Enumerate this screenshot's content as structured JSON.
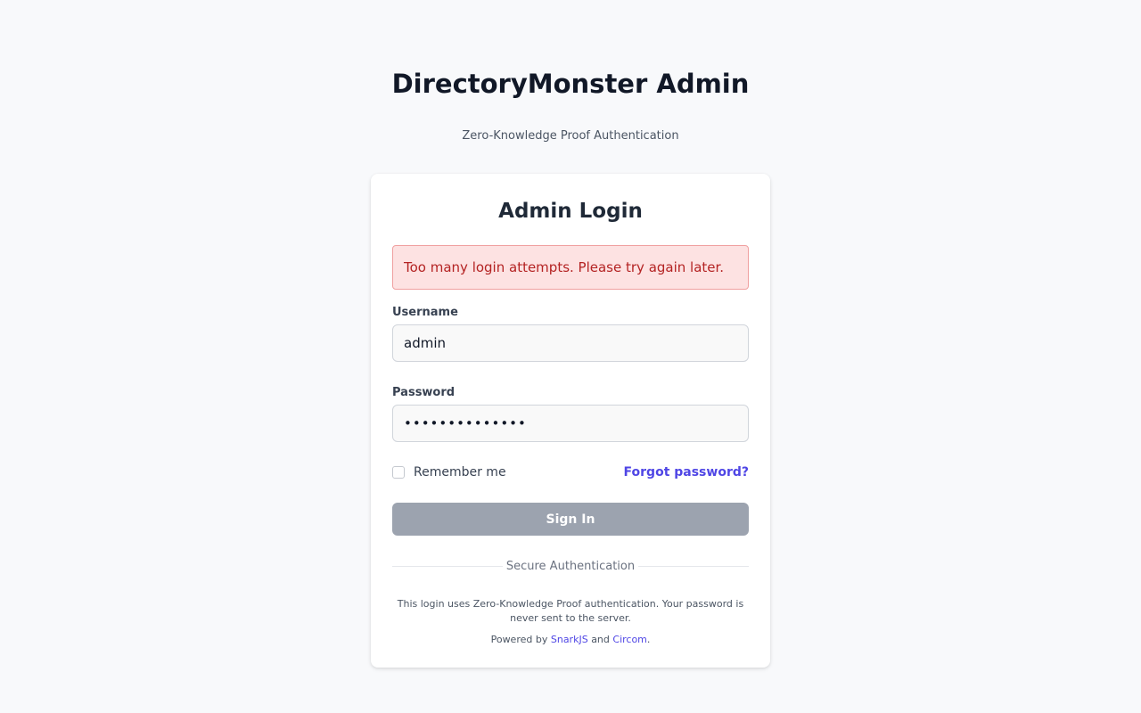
{
  "header": {
    "title": "DirectoryMonster Admin",
    "subtitle": "Zero-Knowledge Proof Authentication"
  },
  "login_card": {
    "title": "Admin Login",
    "error_message": "Too many login attempts. Please try again later.",
    "username": {
      "label": "Username",
      "value": "admin"
    },
    "password": {
      "label": "Password",
      "value": "••••••••••••••"
    },
    "remember_me": {
      "label": "Remember me",
      "checked": false
    },
    "forgot_password_label": "Forgot password?",
    "sign_in_label": "Sign In",
    "divider_text": "Secure Authentication",
    "info_text": "This login uses Zero-Knowledge Proof authentication. Your password is never sent to the server.",
    "powered_by": {
      "prefix": "Powered by",
      "link1": "SnarkJS",
      "conjunction": "and",
      "link2": "Circom",
      "suffix": "."
    }
  },
  "colors": {
    "page_background": "#f8f9fb",
    "error_background": "#fde2e2",
    "error_text": "#b42323",
    "link": "#4f46e5",
    "button_disabled": "#9ca3af"
  }
}
